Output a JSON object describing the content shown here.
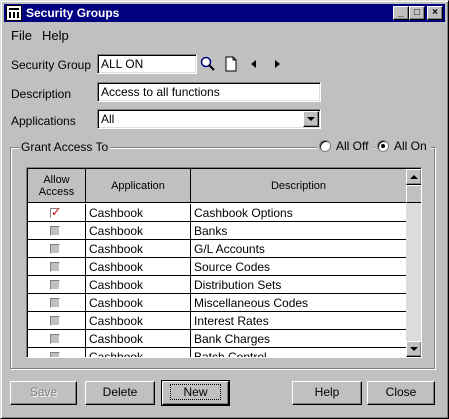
{
  "window": {
    "title": "Security Groups"
  },
  "menu": {
    "file": "File",
    "help": "Help"
  },
  "form": {
    "security_group_label": "Security Group",
    "security_group_value": "ALL ON",
    "description_label": "Description",
    "description_value": "Access to all functions",
    "applications_label": "Applications",
    "applications_value": "All"
  },
  "grant": {
    "title": "Grant Access To",
    "all_off": "All Off",
    "all_on": "All On",
    "selected": "all_on"
  },
  "grid": {
    "headers": [
      "Allow Access",
      "Application",
      "Description"
    ],
    "rows": [
      {
        "allow": true,
        "application": "Cashbook",
        "description": "Cashbook Options"
      },
      {
        "allow": false,
        "application": "Cashbook",
        "description": "Banks"
      },
      {
        "allow": false,
        "application": "Cashbook",
        "description": "G/L Accounts"
      },
      {
        "allow": false,
        "application": "Cashbook",
        "description": "Source Codes"
      },
      {
        "allow": false,
        "application": "Cashbook",
        "description": "Distribution Sets"
      },
      {
        "allow": false,
        "application": "Cashbook",
        "description": "Miscellaneous Codes"
      },
      {
        "allow": false,
        "application": "Cashbook",
        "description": "Interest Rates"
      },
      {
        "allow": false,
        "application": "Cashbook",
        "description": "Bank Charges"
      },
      {
        "allow": false,
        "application": "Cashbook",
        "description": "Batch Control"
      }
    ]
  },
  "buttons": {
    "save": "Save",
    "delete": "Delete",
    "new": "New",
    "help": "Help",
    "close": "Close"
  },
  "colors": {
    "titlebar": "#000080",
    "face": "#c0c0c0",
    "check": "#d00000"
  }
}
